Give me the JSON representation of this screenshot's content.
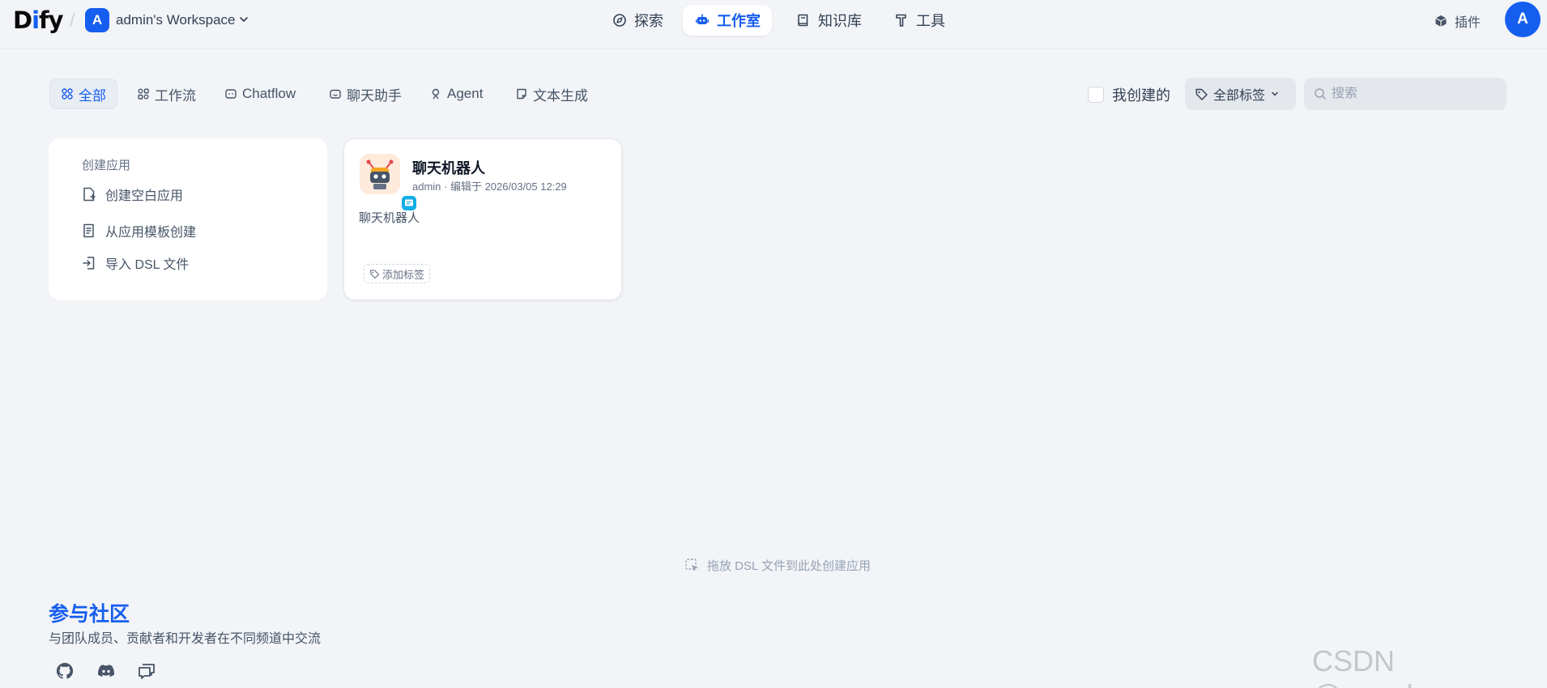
{
  "header": {
    "logo_prefix": "D",
    "logo_i": "i",
    "logo_suffix": "fy",
    "workspace_initial": "A",
    "workspace_name": "admin's Workspace",
    "nav": [
      {
        "label": "探索",
        "icon": "compass-icon"
      },
      {
        "label": "工作室",
        "icon": "robot-icon",
        "active": true
      },
      {
        "label": "知识库",
        "icon": "book-icon"
      },
      {
        "label": "工具",
        "icon": "hammer-icon"
      }
    ],
    "plugin_label": "插件",
    "avatar_initial": "A"
  },
  "filters": {
    "tabs": [
      {
        "label": "全部",
        "icon": "grid-icon",
        "active": true
      },
      {
        "label": "工作流",
        "icon": "workflow-icon"
      },
      {
        "label": "Chatflow",
        "icon": "chatflow-icon"
      },
      {
        "label": "聊天助手",
        "icon": "chat-bot-icon"
      },
      {
        "label": "Agent",
        "icon": "agent-icon"
      },
      {
        "label": "文本生成",
        "icon": "document-icon"
      }
    ],
    "mine_label": "我创建的",
    "mine_checked": false,
    "tag_filter_label": "全部标签",
    "search_placeholder": "搜索",
    "search_value": ""
  },
  "create_card": {
    "title": "创建应用",
    "options": [
      {
        "label": "创建空白应用",
        "icon": "file-plus-icon"
      },
      {
        "label": "从应用模板创建",
        "icon": "template-icon"
      },
      {
        "label": "导入 DSL 文件",
        "icon": "import-icon"
      }
    ]
  },
  "apps": [
    {
      "name": "聊天机器人",
      "meta": "admin · 编辑于 2026/03/05 12:29",
      "description": "聊天机器人",
      "add_tag_label": "添加标签",
      "icon_bg": "#ffeadb",
      "badge_color": "#12aee6"
    }
  ],
  "footer": {
    "drop_hint": "拖放 DSL 文件到此处创建应用",
    "community_title": "参与社区",
    "community_desc": "与团队成员、贡献者和开发者在不同频道中交流",
    "social_icons": [
      "github-icon",
      "discord-icon",
      "forum-icon"
    ]
  },
  "watermark": "CSDN @angelasp",
  "colors": {
    "accent": "#155eef",
    "background": "#f2f4f7",
    "card": "#ffffff"
  }
}
